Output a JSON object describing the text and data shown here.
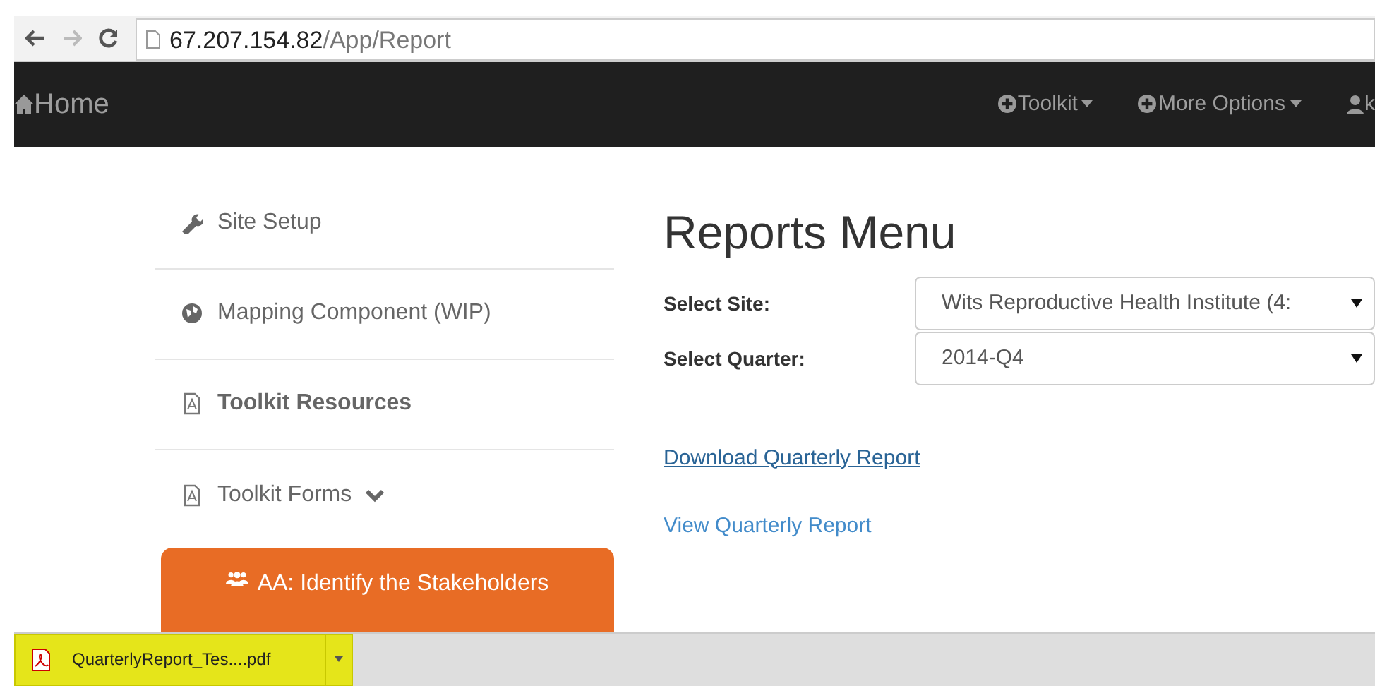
{
  "browser": {
    "url_host": "67.207.154.82",
    "url_path": "/App/Report"
  },
  "navbar": {
    "brand": "Home",
    "menus": [
      {
        "label": "Toolkit",
        "kind": "dropdown"
      },
      {
        "label": "More Options",
        "kind": "dropdown"
      },
      {
        "label": "k",
        "kind": "user"
      }
    ]
  },
  "sidebar": {
    "items": [
      {
        "label": "Site Setup",
        "kind": "tool",
        "emphasized": false,
        "expandable": false,
        "selected": false
      },
      {
        "label": "Mapping Component (WIP)",
        "kind": "map",
        "emphasized": false,
        "expandable": false,
        "selected": false
      },
      {
        "label": "Toolkit Resources",
        "kind": "document",
        "emphasized": true,
        "expandable": false,
        "selected": false
      },
      {
        "label": "Toolkit Forms",
        "kind": "document",
        "emphasized": false,
        "expandable": true,
        "selected": false
      },
      {
        "label": "AA: Identify the Stakeholders",
        "kind": "group",
        "emphasized": false,
        "expandable": false,
        "selected": true
      }
    ]
  },
  "main": {
    "title": "Reports Menu",
    "fields": [
      {
        "label": "Select Site:",
        "value": "Wits Reproductive Health Institute (4:"
      },
      {
        "label": "Select Quarter:",
        "value": "2014-Q4"
      }
    ],
    "links": [
      {
        "label": "Download Quarterly Report",
        "hovered": true
      },
      {
        "label": "View Quarterly Report",
        "hovered": false
      }
    ]
  },
  "downloads": [
    {
      "filename": "QuarterlyReport_Tes....pdf"
    }
  ]
}
